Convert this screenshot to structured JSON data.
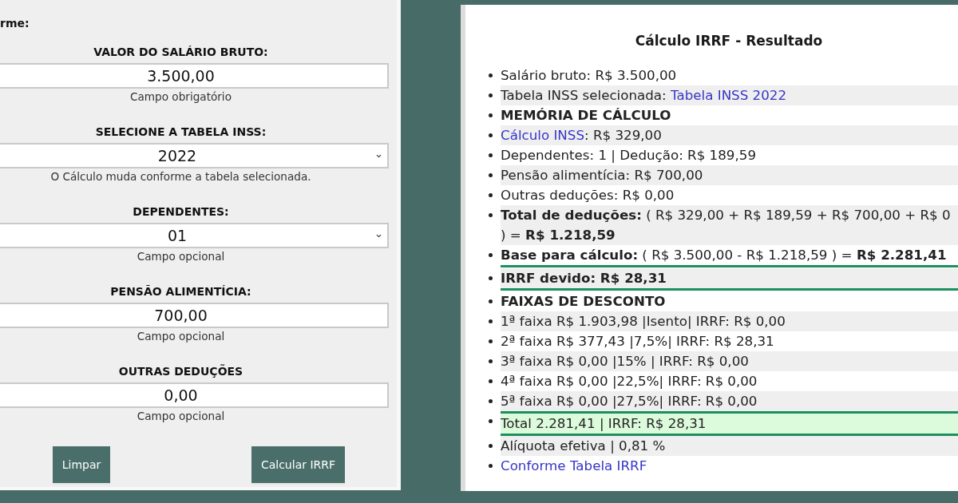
{
  "form": {
    "heading": "rme:",
    "fields": [
      {
        "kind": "input",
        "label": "VALOR DO SALÁRIO BRUTO:",
        "value": "3.500,00",
        "hint": "Campo obrigatório"
      },
      {
        "kind": "select",
        "label": "SELECIONE A TABELA INSS:",
        "value": "2022",
        "hint": "O Cálculo muda conforme a tabela selecionada."
      },
      {
        "kind": "select",
        "label": "DEPENDENTES:",
        "value": "01",
        "hint": "Campo opcional"
      },
      {
        "kind": "input",
        "label": "PENSÃO ALIMENTÍCIA:",
        "value": "700,00",
        "hint": "Campo opcional"
      },
      {
        "kind": "input",
        "label": "OUTRAS DEDUÇÕES",
        "value": "0,00",
        "hint": "Campo opcional"
      }
    ],
    "buttons": [
      "Limpar",
      "Calcular IRRF"
    ]
  },
  "result": {
    "title": "Cálculo IRRF - Resultado",
    "items": [
      {
        "kind": "text",
        "text": "Salário bruto: R$ 3.500,00"
      },
      {
        "kind": "text-link",
        "text": "Tabela INSS selecionada:",
        "link": "Tabela INSS 2022"
      },
      {
        "kind": "text",
        "text": "**MEMÓRIA DE CÁLCULO**"
      },
      {
        "kind": "link-text",
        "link": "Cálculo INSS",
        "text": ": R$ 329,00"
      },
      {
        "kind": "text",
        "text": "Dependentes: 1 | Dedução: R$ 189,59"
      },
      {
        "kind": "text",
        "text": "Pensão alimentícia: R$ 700,00"
      },
      {
        "kind": "text",
        "text": "Outras deduções: R$ 0,00"
      },
      {
        "kind": "lines",
        "lines": [
          "**Total de deduções:** ( R$ 329,00 + R$ 189,59 + R$ 700,00 + R$ 0",
          ") = **R$ 1.218,59**"
        ]
      },
      {
        "kind": "underlined",
        "text": "**Base para cálculo:** ( R$ 3.500,00 - R$ 1.218,59 ) = **R$ 2.281,41**"
      },
      {
        "kind": "underlined",
        "text": "**IRRF devido: R$ 28,31**"
      },
      {
        "kind": "text",
        "text": "**FAIXAS DE DESCONTO**"
      },
      {
        "kind": "text",
        "text": "1ª faixa R$ 1.903,98 |Isento| IRRF: R$ 0,00"
      },
      {
        "kind": "text",
        "text": "2ª faixa R$ 377,43 |7,5%| IRRF: R$ 28,31"
      },
      {
        "kind": "text",
        "text": "3ª faixa R$ 0,00 |15% | IRRF: R$ 0,00"
      },
      {
        "kind": "text",
        "text": "4ª faixa R$ 0,00 |22,5%| IRRF: R$ 0,00"
      },
      {
        "kind": "text",
        "text": "5ª faixa R$ 0,00 |27,5%| IRRF: R$ 0,00"
      },
      {
        "kind": "total",
        "text": "Total 2.281,41 | IRRF: R$ 28,31"
      },
      {
        "kind": "text",
        "text": "Alíquota efetiva | 0,81 %"
      },
      {
        "kind": "link",
        "link": "Conforme Tabela IRRF"
      }
    ]
  }
}
